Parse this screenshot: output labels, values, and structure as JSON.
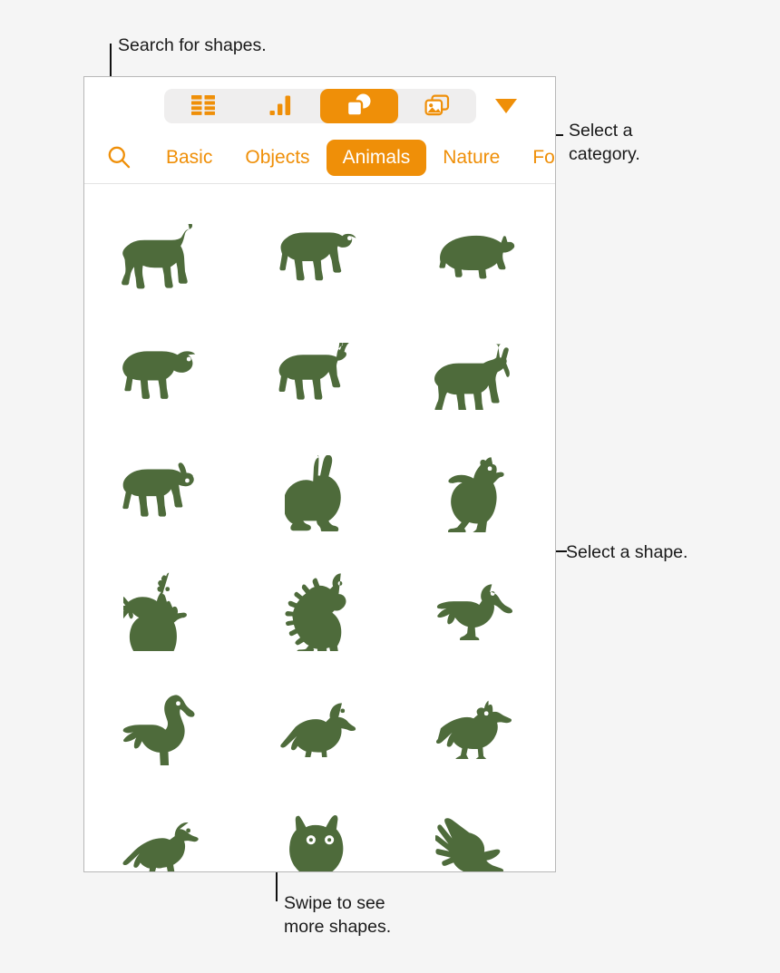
{
  "annotations": [
    {
      "id": "search",
      "text": "Search for shapes."
    },
    {
      "id": "category",
      "text": "Select a\ncategory."
    },
    {
      "id": "shape",
      "text": "Select a shape."
    },
    {
      "id": "swipe",
      "text": "Swipe to see\nmore shapes."
    }
  ],
  "panel": {
    "accent_color": "#ef8f08",
    "shape_color": "#4e6b3b",
    "background_color": "#ffffff",
    "segmented_track_color": "#efeeee",
    "segmented_control": {
      "items": [
        {
          "icon": "table-icon",
          "label": "Table",
          "selected": false
        },
        {
          "icon": "chart-icon",
          "label": "Chart",
          "selected": false
        },
        {
          "icon": "shapes-icon",
          "label": "Shape",
          "selected": true
        },
        {
          "icon": "media-icon",
          "label": "Media",
          "selected": false
        }
      ]
    },
    "disclosure_icon": "chevron-down-triangle-icon",
    "search_icon": "search-icon",
    "categories": [
      {
        "label": "Basic",
        "selected": false
      },
      {
        "label": "Objects",
        "selected": false
      },
      {
        "label": "Animals",
        "selected": true
      },
      {
        "label": "Nature",
        "selected": false
      },
      {
        "label": "Food",
        "selected": false
      }
    ],
    "shapes": [
      {
        "name": "horse-shape"
      },
      {
        "name": "cow-shape"
      },
      {
        "name": "pig-shape"
      },
      {
        "name": "sheep-shape"
      },
      {
        "name": "goat-shape"
      },
      {
        "name": "donkey-shape"
      },
      {
        "name": "bull-shape"
      },
      {
        "name": "rabbit-shape"
      },
      {
        "name": "hen-shape"
      },
      {
        "name": "rooster-shape"
      },
      {
        "name": "turkey-shape"
      },
      {
        "name": "duck-shape"
      },
      {
        "name": "goose-shape"
      },
      {
        "name": "crow-shape"
      },
      {
        "name": "jay-shape"
      },
      {
        "name": "sparrow-shape"
      },
      {
        "name": "owl-shape"
      },
      {
        "name": "flying-bird-shape"
      }
    ]
  }
}
